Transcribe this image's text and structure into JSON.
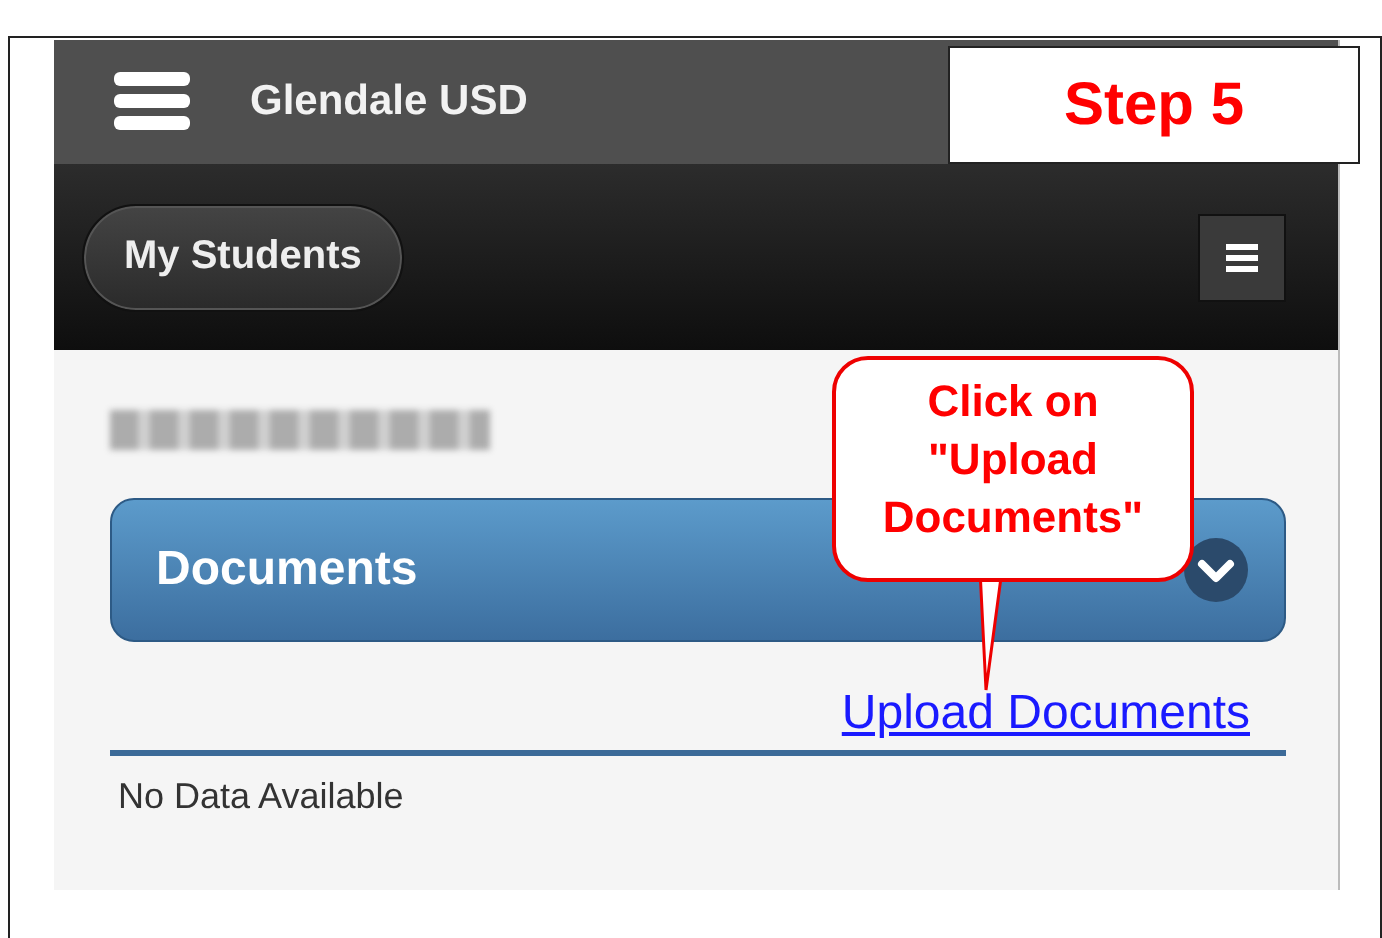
{
  "step_label": "Step 5",
  "header": {
    "title": "Glendale USD"
  },
  "toolbar": {
    "button": "My Students"
  },
  "student": {
    "name_blurred": true
  },
  "section": {
    "title": "Documents"
  },
  "callout": {
    "lines": [
      "Click on",
      "\"Upload",
      "Documents\""
    ]
  },
  "upload_link": "Upload Documents",
  "empty_message": "No Data Available"
}
